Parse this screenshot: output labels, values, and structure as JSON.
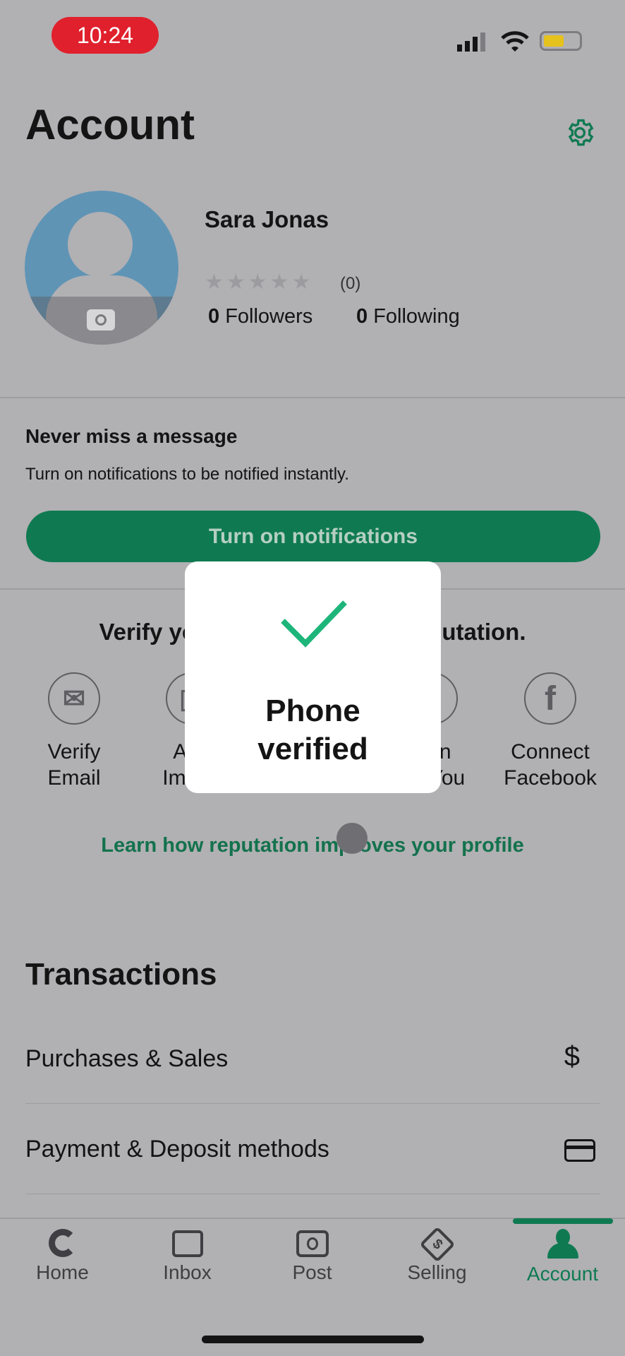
{
  "status_bar": {
    "time": "10:24"
  },
  "header": {
    "title": "Account",
    "settings_icon": "gear-icon"
  },
  "profile": {
    "name": "Sara Jonas",
    "rating_count": "(0)",
    "rating_stars": 0,
    "followers_count": "0",
    "followers_label": "Followers",
    "following_count": "0",
    "following_label": "Following"
  },
  "notifications": {
    "title": "Never miss a message",
    "subtitle": "Turn on notifications to be notified instantly.",
    "button": "Turn on notifications"
  },
  "verify": {
    "heading": "Verify your identity to build reputation.",
    "items": [
      {
        "line1": "Verify",
        "line2": "Email",
        "icon": "envelope-icon"
      },
      {
        "line1": "Add",
        "line2": "Image",
        "icon": "image-icon"
      },
      {
        "line1": "Join",
        "line2": "TruYou",
        "icon": "shield-icon"
      },
      {
        "line1": "Connect",
        "line2": "Facebook",
        "icon": "facebook-icon"
      }
    ],
    "learn_link": "Learn how reputation improves your profile"
  },
  "modal": {
    "line1": "Phone",
    "line2": "verified",
    "icon": "checkmark-icon"
  },
  "transactions": {
    "title": "Transactions",
    "rows": [
      {
        "label": "Purchases & Sales",
        "icon": "dollar-icon"
      },
      {
        "label": "Payment & Deposit methods",
        "icon": "credit-card-icon"
      }
    ]
  },
  "nav": [
    {
      "label": "Home"
    },
    {
      "label": "Inbox"
    },
    {
      "label": "Post"
    },
    {
      "label": "Selling"
    },
    {
      "label": "Account",
      "active": true
    }
  ],
  "colors": {
    "accent": "#0f7a52",
    "overlay": "#b1b0b3",
    "check": "#1db57a"
  }
}
